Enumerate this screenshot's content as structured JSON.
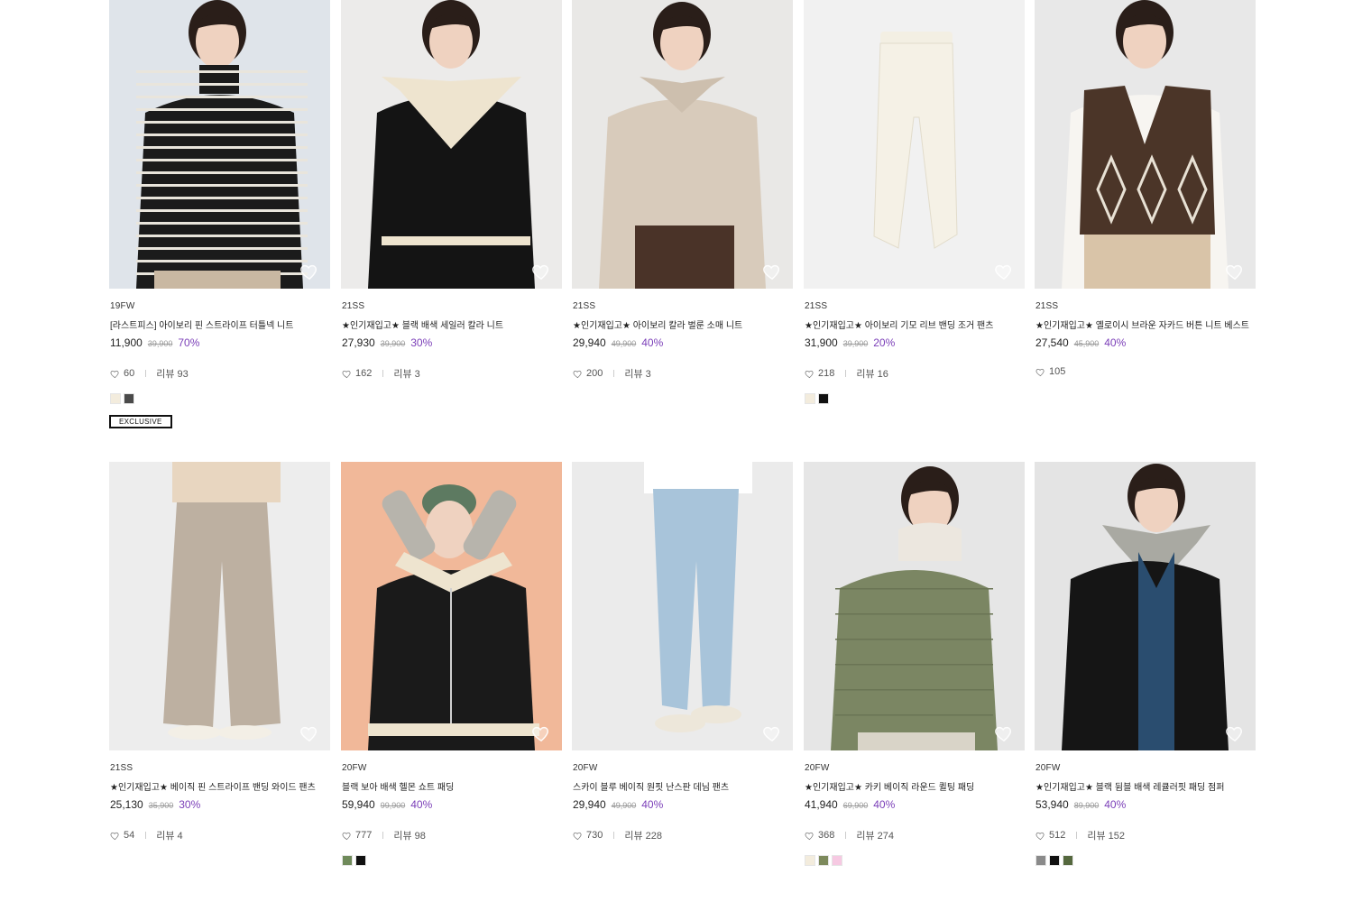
{
  "products": [
    {
      "season": "19FW",
      "name": "[라스트피스] 아이보리 핀 스트라이프 터틀넥 니트",
      "price": "11,900",
      "original": "39,900",
      "discount": "70%",
      "likes": "60",
      "reviews": "리뷰 93",
      "colors": [
        "#f3ecdd",
        "#4a4a4a"
      ],
      "badge": "EXCLUSIVE",
      "image": "striped-turtleneck-model"
    },
    {
      "season": "21SS",
      "name": "★인기재입고★ 블랙 배색 세일러 칼라 니트",
      "price": "27,930",
      "original": "39,900",
      "discount": "30%",
      "likes": "162",
      "reviews": "리뷰 3",
      "colors": [],
      "image": "sailor-collar-knit-model"
    },
    {
      "season": "21SS",
      "name": "★인기재입고★ 아이보리 칼라 벌룬 소매 니트",
      "price": "29,940",
      "original": "49,900",
      "discount": "40%",
      "likes": "200",
      "reviews": "리뷰 3",
      "colors": [],
      "image": "collar-balloon-sleeve-knit-model"
    },
    {
      "season": "21SS",
      "name": "★인기재입고★ 아이보리 기모 리브 밴딩 조거 팬츠",
      "price": "31,900",
      "original": "39,900",
      "discount": "20%",
      "likes": "218",
      "reviews": "리뷰 16",
      "colors": [
        "#f3ecdd",
        "#111111"
      ],
      "image": "ivory-jogger-pants"
    },
    {
      "season": "21SS",
      "name": "★인기재입고★ 옐로이시 브라운 자카드 버튼 니트 베스트",
      "price": "27,540",
      "original": "45,900",
      "discount": "40%",
      "likes": "105",
      "reviews": "",
      "colors": [],
      "image": "jacquard-knit-vest-model"
    },
    {
      "season": "21SS",
      "name": "★인기재입고★ 베이직 핀 스트라이프 밴딩 와이드 팬츠",
      "price": "25,130",
      "original": "35,900",
      "discount": "30%",
      "likes": "54",
      "reviews": "리뷰 4",
      "colors": [],
      "image": "wide-pants-model"
    },
    {
      "season": "20FW",
      "name": "블랙 보아 배색 헬몬 쇼트 패딩",
      "price": "59,940",
      "original": "99,900",
      "discount": "40%",
      "likes": "777",
      "reviews": "리뷰 98",
      "colors": [
        "#6f8a5a",
        "#111111"
      ],
      "image": "boa-short-padding-model"
    },
    {
      "season": "20FW",
      "name": "스카이 블루 베이직 원핏 난스판 데님 팬츠",
      "price": "29,940",
      "original": "49,900",
      "discount": "40%",
      "likes": "730",
      "reviews": "리뷰 228",
      "colors": [],
      "image": "denim-pants-model"
    },
    {
      "season": "20FW",
      "name": "★인기재입고★ 카키 베이직 라운드 퀼팅 패딩",
      "price": "41,940",
      "original": "69,900",
      "discount": "40%",
      "likes": "368",
      "reviews": "리뷰 274",
      "colors": [
        "#f3ecdd",
        "#7d8a5c",
        "#f6c9e2"
      ],
      "image": "khaki-quilted-padding-model"
    },
    {
      "season": "20FW",
      "name": "★인기재입고★ 블랙 뒴블 배색 레큘러핏 패딩 점퍼",
      "price": "53,940",
      "original": "89,900",
      "discount": "40%",
      "likes": "512",
      "reviews": "리뷰 152",
      "colors": [
        "#8a8a8a",
        "#111111",
        "#55683e"
      ],
      "image": "black-padding-jumper-model"
    }
  ]
}
